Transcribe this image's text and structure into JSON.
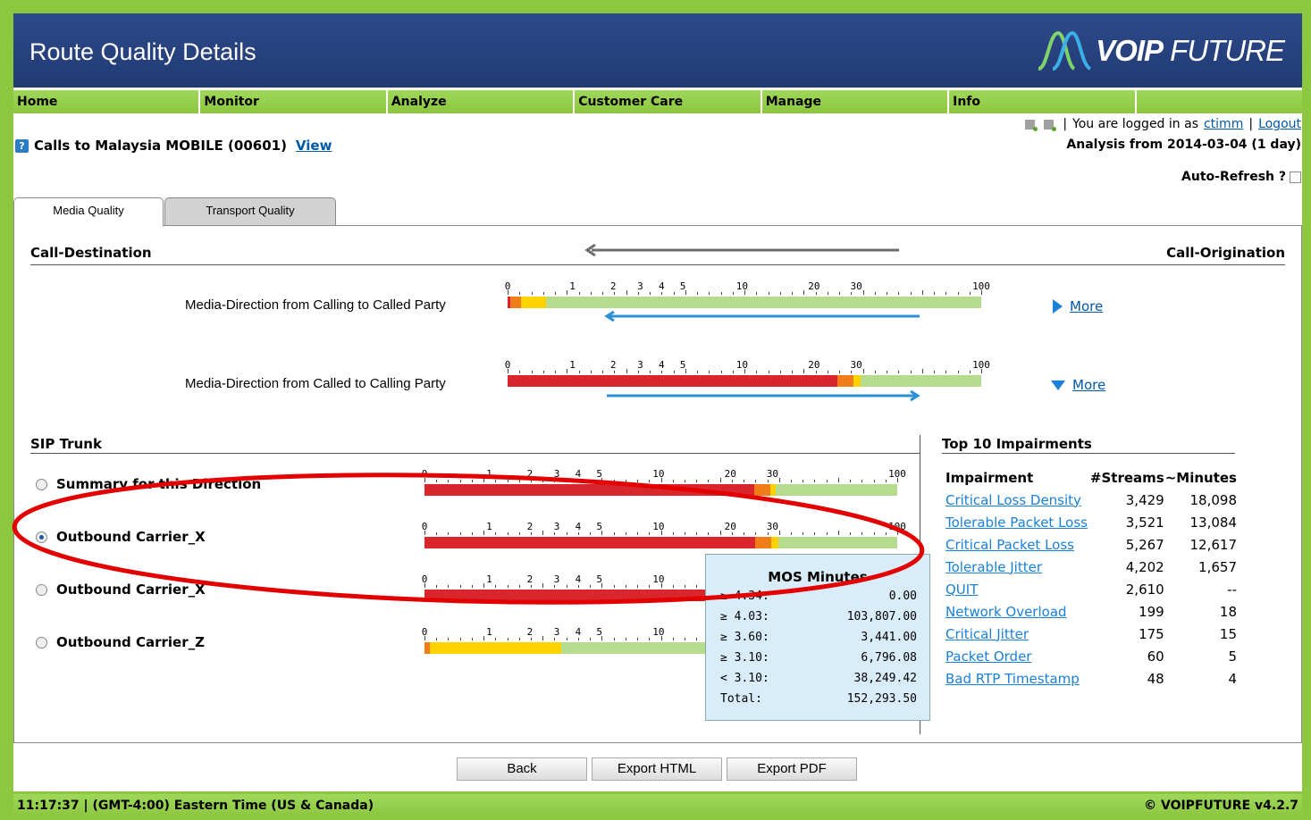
{
  "header": {
    "title": "Route Quality Details",
    "logo_text_bold": "VOIP",
    "logo_text": " FUTURE"
  },
  "nav": [
    "Home",
    "Monitor",
    "Analyze",
    "Customer Care",
    "Manage",
    "Info",
    ""
  ],
  "session": {
    "prefix": "You are logged in as",
    "user": "ctimm",
    "separator": "|",
    "logout": "Logout"
  },
  "analysis_range": "Analysis from 2014-03-04 (1 day)",
  "route": {
    "title": "Calls to Malaysia MOBILE (00601)",
    "view_link": "View"
  },
  "auto_refresh": "Auto-Refresh ?",
  "tabs": {
    "media": "Media Quality",
    "transport": "Transport Quality"
  },
  "directions": {
    "destination": "Call-Destination",
    "origination": "Call-Origination",
    "calling_to_called": "Media-Direction from Calling to Called Party",
    "called_to_calling": "Media-Direction from Called to Calling Party",
    "more": "More"
  },
  "scale_ticks": [
    "0",
    "1",
    "2",
    "3",
    "4",
    "5",
    "10",
    "20",
    "30",
    "100"
  ],
  "sip_trunk": {
    "heading": "SIP Trunk",
    "rows": [
      {
        "label": "Summary for this Direction",
        "selected": false
      },
      {
        "label": "Outbound Carrier_X",
        "selected": true
      },
      {
        "label": "Outbound Carrier_X",
        "selected": false
      },
      {
        "label": "Outbound Carrier_Z",
        "selected": false
      }
    ]
  },
  "impairments": {
    "heading": "Top 10 Impairments",
    "columns": [
      "Impairment",
      "#Streams",
      "~Minutes"
    ],
    "rows": [
      {
        "name": "Critical Loss Density",
        "streams": "3,429",
        "minutes": "18,098"
      },
      {
        "name": "Tolerable Packet Loss",
        "streams": "3,521",
        "minutes": "13,084"
      },
      {
        "name": "Critical Packet Loss",
        "streams": "5,267",
        "minutes": "12,617"
      },
      {
        "name": "Tolerable Jitter",
        "streams": "4,202",
        "minutes": "1,657"
      },
      {
        "name": "QUIT",
        "streams": "2,610",
        "minutes": "--"
      },
      {
        "name": "Network Overload",
        "streams": "199",
        "minutes": "18"
      },
      {
        "name": "Critical Jitter",
        "streams": "175",
        "minutes": "15"
      },
      {
        "name": "Packet Order",
        "streams": "60",
        "minutes": "5"
      },
      {
        "name": "Bad RTP Timestamp",
        "streams": "48",
        "minutes": "4"
      }
    ]
  },
  "tooltip": {
    "title": "MOS Minutes",
    "rows": [
      {
        "label": "≥ 4.34:",
        "value": "0.00"
      },
      {
        "label": "≥ 4.03:",
        "value": "103,807.00"
      },
      {
        "label": "≥ 3.60:",
        "value": "3,441.00"
      },
      {
        "label": "≥ 3.10:",
        "value": "6,796.08"
      },
      {
        "label": "< 3.10:",
        "value": "38,249.42"
      },
      {
        "label": "Total:",
        "value": "152,293.50"
      }
    ]
  },
  "buttons": {
    "back": "Back",
    "export_html": "Export HTML",
    "export_pdf": "Export PDF"
  },
  "footer": {
    "time": "11:17:37 | (GMT-4:00) Eastern Time (US & Canada)",
    "version": "© VOIPFUTURE v4.2.7"
  },
  "colors": {
    "red": "#d9262c",
    "orange": "#f07d1a",
    "yellow": "#ffd200",
    "green": "#b5dc8e",
    "accent_blue": "#1a80d8",
    "nav_green": "#8dc63f",
    "header_blue": "#213a72",
    "annotation_red": "#e30000"
  }
}
